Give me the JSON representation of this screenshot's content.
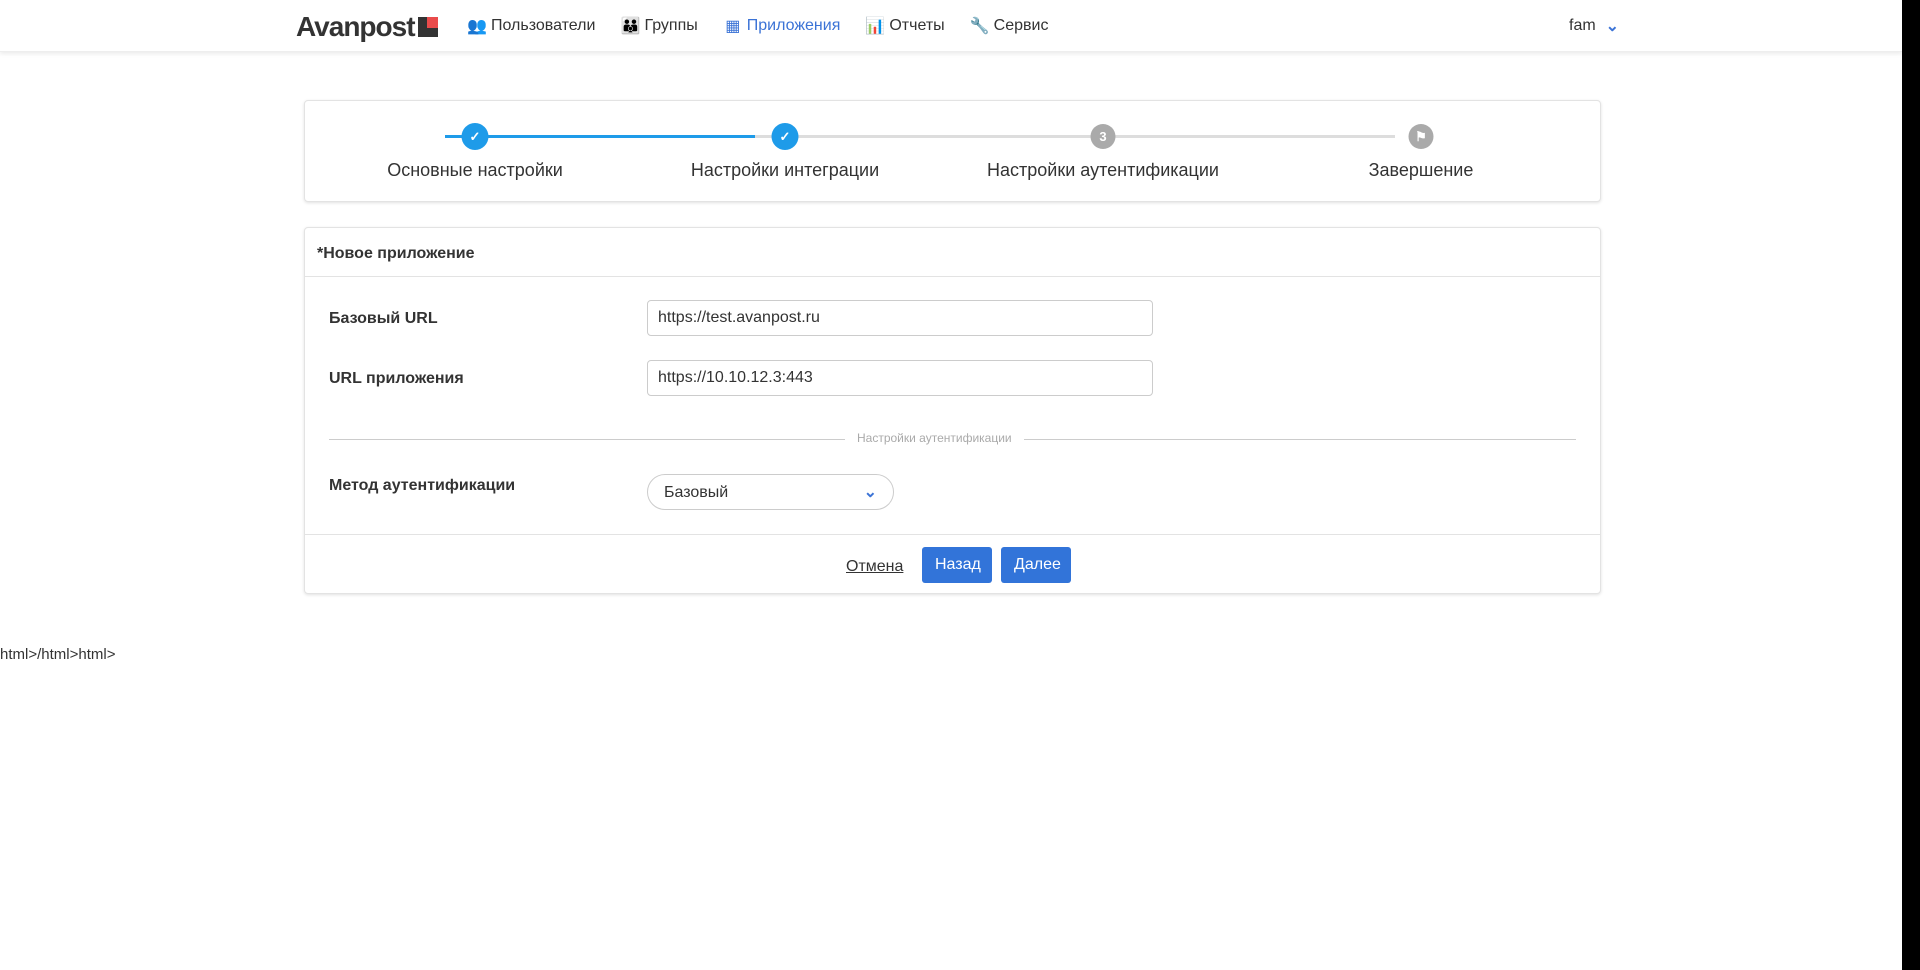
{
  "nav": {
    "logo": "Avanpost",
    "items": [
      {
        "label": "Пользователи",
        "icon": "users-icon"
      },
      {
        "label": "Группы",
        "icon": "groups-icon"
      },
      {
        "label": "Приложения",
        "icon": "grid-icon",
        "active": true
      },
      {
        "label": "Отчеты",
        "icon": "chart-icon"
      },
      {
        "label": "Сервис",
        "icon": "wrench-icon"
      }
    ],
    "user": "fam"
  },
  "steps": [
    {
      "label": "Основные настройки",
      "state": "done"
    },
    {
      "label": "Настройки интеграции",
      "state": "done"
    },
    {
      "label": "Настройки аутентификации",
      "state": "todo",
      "number": "3"
    },
    {
      "label": "Завершение",
      "state": "todo"
    }
  ],
  "form": {
    "title": "*Новое приложение",
    "base_url_label": "Базовый URL",
    "base_url_value": "https://test.avanpost.ru",
    "app_url_label": "URL приложения",
    "app_url_value": "https://10.10.12.3:443",
    "section": "Настройки аутентификации",
    "auth_method_label": "Метод аутентификации",
    "auth_method_value": "Базовый",
    "cancel": "Отмена",
    "back": "Назад",
    "next": "Далее"
  },
  "stray_text": "html>/html>html>",
  "colors": {
    "accent": "#1e9be9",
    "button": "#3274d9",
    "link": "#3b73d6"
  }
}
